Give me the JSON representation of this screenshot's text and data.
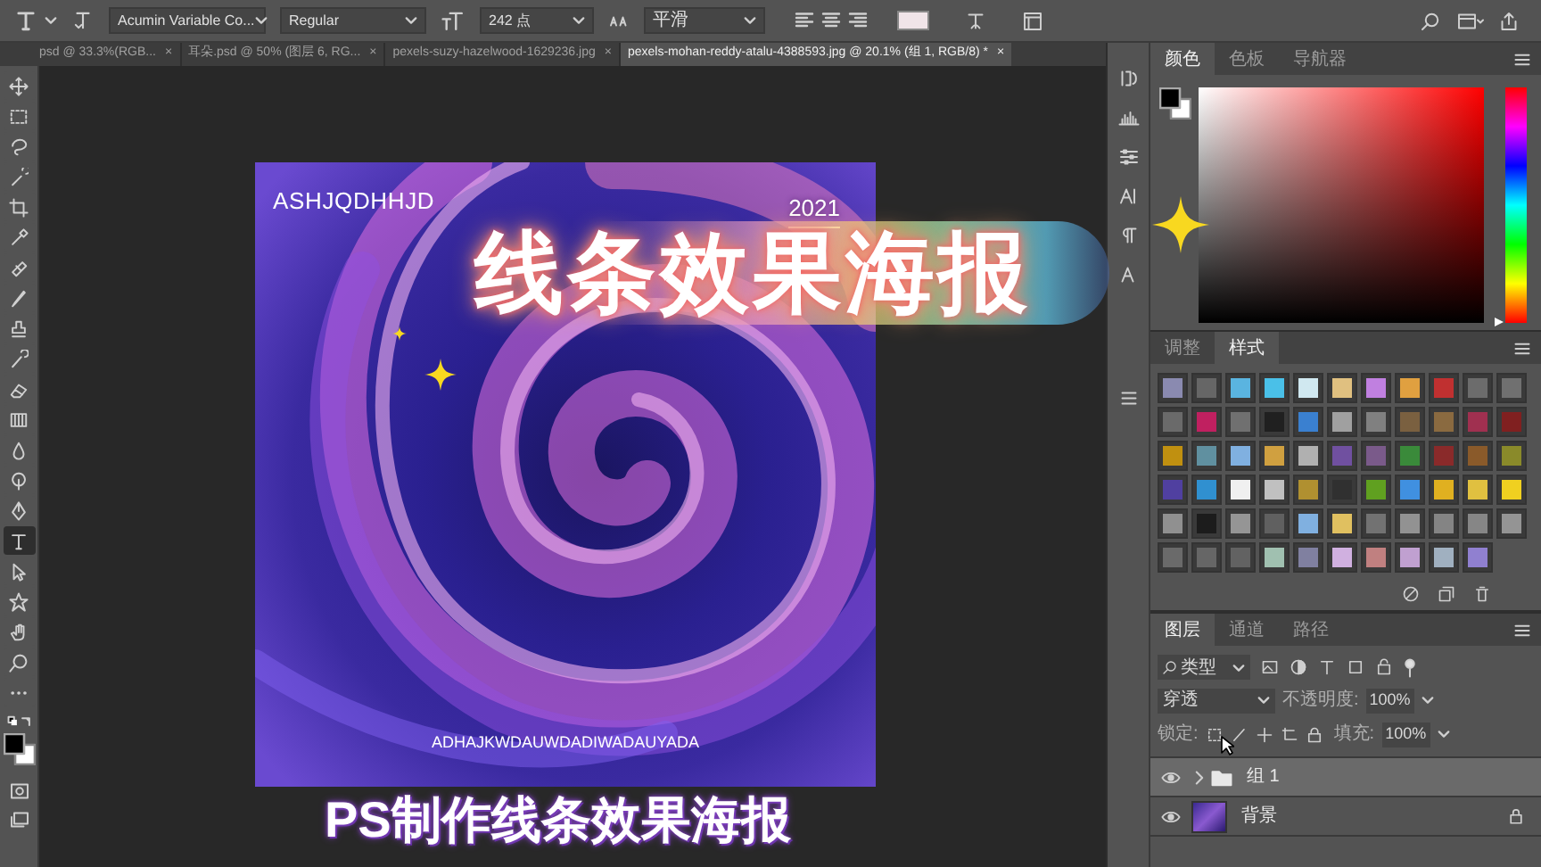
{
  "options_bar": {
    "font_family": "Acumin Variable Co...",
    "font_style": "Regular",
    "font_size": "242 点",
    "antialias": "平滑"
  },
  "document_tabs": [
    {
      "label": "psd @ 33.3%(RGB...",
      "close": "×",
      "selected": false
    },
    {
      "label": "耳朵.psd @ 50% (图层 6, RG...",
      "close": "×",
      "selected": false
    },
    {
      "label": "pexels-suzy-hazelwood-1629236.jpg",
      "close": "×",
      "selected": false
    },
    {
      "label": "pexels-mohan-reddy-atalu-4388593.jpg @ 20.1% (组 1, RGB/8) *",
      "close": "×",
      "selected": true
    }
  ],
  "tools": [
    {
      "selected": false
    },
    {
      "selected": false
    },
    {
      "selected": false
    },
    {
      "selected": false
    },
    {
      "selected": false
    },
    {
      "selected": false
    },
    {
      "selected": false
    },
    {
      "selected": false
    },
    {
      "selected": false
    },
    {
      "selected": false
    },
    {
      "selected": false
    },
    {
      "selected": false
    },
    {
      "selected": false
    },
    {
      "selected": false
    },
    {
      "selected": false
    },
    {
      "selected": true
    },
    {
      "selected": false
    },
    {
      "selected": false
    },
    {
      "selected": false
    },
    {
      "selected": false
    },
    {
      "selected": false
    }
  ],
  "poster": {
    "title": "ASHJQDHHJD",
    "year": "2021",
    "caption": "ADHAJKWDAUWDADIWADAUYADA"
  },
  "overlay": {
    "headline": "线条效果海报",
    "subtitle": "PS制作线条效果海报"
  },
  "color_panel": {
    "tabs": [
      {
        "label": "颜色",
        "selected": true
      },
      {
        "label": "色板",
        "selected": false
      },
      {
        "label": "导航器",
        "selected": false
      }
    ],
    "hue_slider": {
      "level": 0
    }
  },
  "styles_panel": {
    "tabs": [
      {
        "label": "调整",
        "selected": false
      },
      {
        "label": "样式",
        "selected": true
      }
    ],
    "swatches": [
      {
        "color": "#8a8ab0"
      },
      {
        "color": "#666666"
      },
      {
        "color": "#5ab4e0"
      },
      {
        "color": "#4ac0e8"
      },
      {
        "color": "#d0e8f0"
      },
      {
        "color": "#e0c080"
      },
      {
        "color": "#c080e0"
      },
      {
        "color": "#e0a040"
      },
      {
        "color": "#c03030"
      },
      {
        "color": "#6c6c6c"
      },
      {
        "color": "#707070"
      },
      {
        "color": "#6a6a6a"
      },
      {
        "color": "#c02060"
      },
      {
        "color": "#707070"
      },
      {
        "color": "#202020"
      },
      {
        "color": "#3a80d0"
      },
      {
        "color": "#a0a0a0"
      },
      {
        "color": "#808080"
      },
      {
        "color": "#7a6040"
      },
      {
        "color": "#8a6a40"
      },
      {
        "color": "#a03050"
      },
      {
        "color": "#802020"
      },
      {
        "color": "#c09010"
      },
      {
        "color": "#6090a0"
      },
      {
        "color": "#80b0e0"
      },
      {
        "color": "#d0a040"
      },
      {
        "color": "#b0b0b0"
      },
      {
        "color": "#7050a0"
      },
      {
        "color": "#7a5a8a"
      },
      {
        "color": "#3a8a3a"
      },
      {
        "color": "#8a2a2a"
      },
      {
        "color": "#8a5a2a"
      },
      {
        "color": "#8a8a2a"
      },
      {
        "color": "#5040a0"
      },
      {
        "color": "#3090d0"
      },
      {
        "color": "#f0f0f0"
      },
      {
        "color": "#c0c0c0"
      },
      {
        "color": "#b09030"
      },
      {
        "color": "#303030"
      },
      {
        "color": "#60a020"
      },
      {
        "color": "#4090e0"
      },
      {
        "color": "#e0b020"
      },
      {
        "color": "#e0c040"
      },
      {
        "color": "#f0d020"
      },
      {
        "color": "#909090"
      },
      {
        "color": "#1c1c1c"
      },
      {
        "color": "#959595"
      },
      {
        "color": "#606060"
      },
      {
        "color": "#80b0e0"
      },
      {
        "color": "#e0c060"
      },
      {
        "color": "#727272"
      },
      {
        "color": "#929292"
      },
      {
        "color": "#848484"
      },
      {
        "color": "#868686"
      },
      {
        "color": "#949494"
      },
      {
        "color": "#6a6a6a"
      },
      {
        "color": "#666666"
      },
      {
        "color": "#626262"
      },
      {
        "color": "#a0c0b0"
      },
      {
        "color": "#8080a0"
      },
      {
        "color": "#d0b0e0"
      },
      {
        "color": "#c08080"
      },
      {
        "color": "#c0a0d0"
      },
      {
        "color": "#a0b0c0"
      },
      {
        "color": "#9080d0"
      }
    ]
  },
  "layers_panel": {
    "tabs": [
      {
        "label": "图层",
        "selected": true
      },
      {
        "label": "通道",
        "selected": false
      },
      {
        "label": "路径",
        "selected": false
      }
    ],
    "filter": "类型",
    "blend_mode": "穿透",
    "opacity_label": "不透明度:",
    "opacity": "100%",
    "lock_label": "锁定:",
    "fill_label": "填充:",
    "fill": "100%",
    "layers": [
      {
        "name": "组 1",
        "kind": "group",
        "selected": true,
        "visible": true,
        "locked": false
      },
      {
        "name": "背景",
        "kind": "image",
        "selected": false,
        "visible": true,
        "locked": true
      }
    ]
  }
}
